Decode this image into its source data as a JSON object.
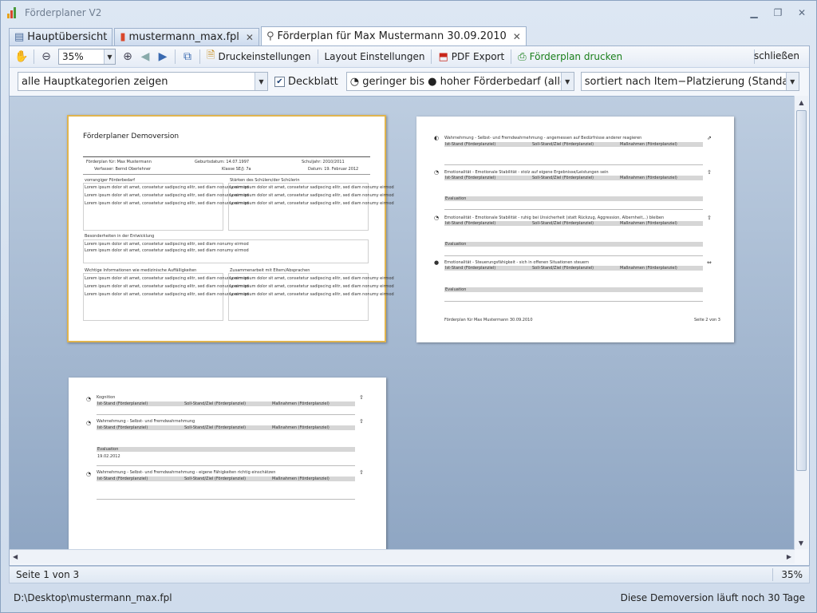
{
  "app": {
    "title": "Förderplaner V2"
  },
  "tabs": [
    {
      "label": "Hauptübersicht",
      "icon": "grid-icon"
    },
    {
      "label": "mustermann_max.fpl",
      "icon": "chart-icon"
    },
    {
      "label": "Förderplan für Max Mustermann 30.09.2010",
      "icon": "magnifier-icon"
    }
  ],
  "toolbar": {
    "zoom": "35%",
    "print_settings": "Druckeinstellungen",
    "layout_settings": "Layout Einstellungen",
    "pdf_export": "PDF Export",
    "print_plan": "Förderplan drucken",
    "close": "schließen"
  },
  "filters": {
    "category": "alle Hauptkategorien zeigen",
    "cover_sheet": "Deckblatt",
    "range": "◔ geringer  bis ● hoher Förderbedarf (alles)",
    "sort": "sortiert nach Item−Platzierung (Standard)"
  },
  "pages": {
    "p1": {
      "title": "Förderplaner Demoversion",
      "for": "Förderplan für: Max Mustermann",
      "birth": "Geburtsdatum: 14.07.1997",
      "schoolyear": "Schuljahr: 2010/2011",
      "author": "Verfasser: Bernd Oberlehner",
      "class": "Klasse SE/J: 7a",
      "date": "Datum: 19. Februar 2012",
      "sec1": "vorrangiger Förderbedarf",
      "sec2": "Stärken des Schülers/der Schülerin",
      "sec3": "Besonderheiten in der Entwicklung",
      "sec4": "Wichtige Informationen wie medizinische Auffälligkeiten",
      "sec5": "Zusammenarbeit mit Eltern/Absprachen",
      "lorem": "Lorem ipsum dolor sit amet, consetetur sadipscing elitr, sed diam nonumy eirmod"
    },
    "p2": {
      "items": [
        "Wahrnehmung - Selbst- und Fremdwahrnehmung - angemessen auf Bedürfnisse anderer reagieren",
        "Emotionalität - Emotionale Stabilität - stolz auf eigene Ergebnisse/Leistungen sein",
        "Emotionalität - Emotionale Stabilität - ruhig bei Unsicherheit (statt Rückzug, Aggression, Albernheit,..) bleiben",
        "Emotionalität - Steuerungsfähigkeit - sich in offenen Situationen steuern"
      ],
      "col1": "Ist-Stand (Förderplanziel)",
      "col2": "Soll-Stand/Ziel (Förderplanziel)",
      "col3": "Maßnahmen (Förderplanziel)",
      "eval": "Evaluation",
      "footer_left": "Förderplan für Max Mustermann 30.09.2010",
      "footer_right": "Seite 2 von 3"
    },
    "p3": {
      "items": [
        "Kognition",
        "Wahrnehmung - Selbst- und Fremdwahrnehmung",
        "Wahrnehmung - Selbst- und Fremdwahrnehmung - eigene Fähigkeiten richtig einschätzen"
      ],
      "eval_date": "19.02.2012"
    }
  },
  "status": {
    "page": "Seite 1 von 3",
    "zoom": "35%"
  },
  "footer": {
    "path": "D:\\Desktop\\mustermann_max.fpl",
    "demo": "Diese Demoversion läuft noch 30 Tage"
  },
  "colors": {
    "accent_green": "#1a7f1a",
    "selection_border": "#e0b44e",
    "preview_bg": "#8fa6c3"
  }
}
